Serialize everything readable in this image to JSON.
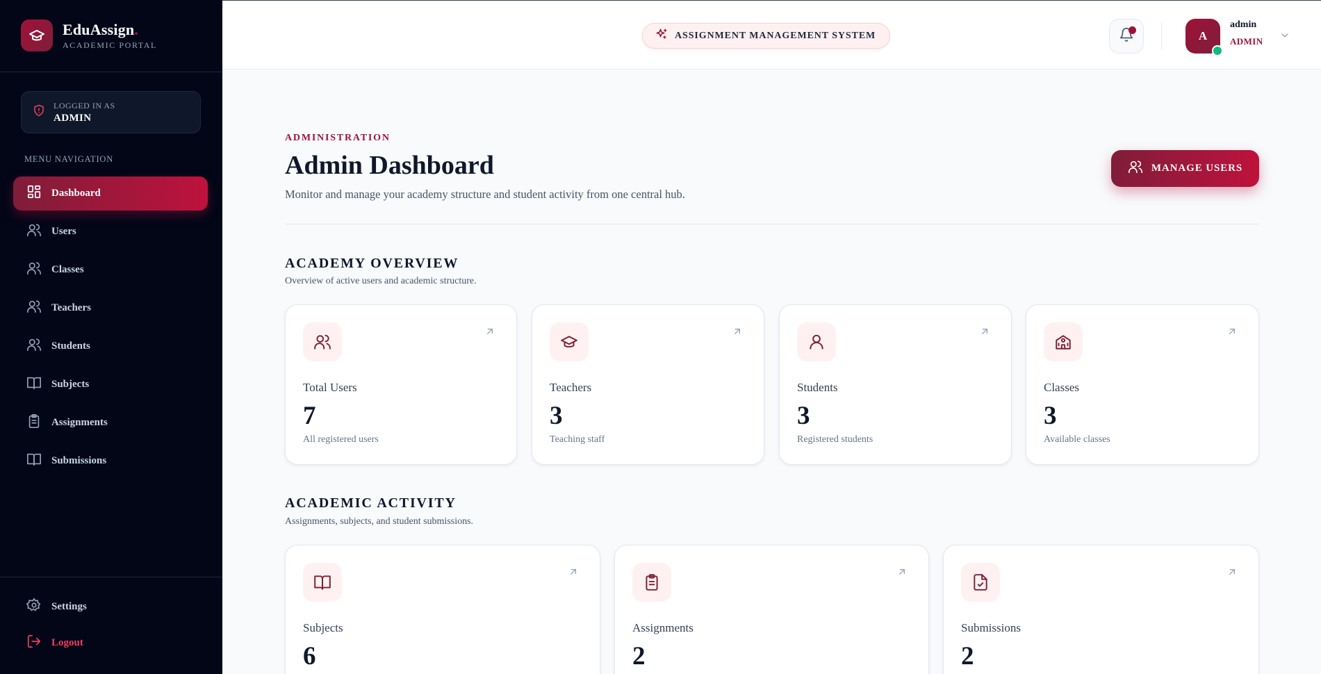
{
  "brand": {
    "name": "EduAssign",
    "dot": ".",
    "subtitle": "ACADEMIC PORTAL"
  },
  "login": {
    "label": "LOGGED IN AS",
    "role": "ADMIN"
  },
  "menu": {
    "heading": "MENU NAVIGATION",
    "items": [
      {
        "label": "Dashboard",
        "icon": "dashboard-icon",
        "active": true
      },
      {
        "label": "Users",
        "icon": "users-icon"
      },
      {
        "label": "Classes",
        "icon": "users-icon"
      },
      {
        "label": "Teachers",
        "icon": "users-icon"
      },
      {
        "label": "Students",
        "icon": "users-icon"
      },
      {
        "label": "Subjects",
        "icon": "book-icon"
      },
      {
        "label": "Assignments",
        "icon": "clipboard-icon"
      },
      {
        "label": "Submissions",
        "icon": "book-icon"
      }
    ],
    "bottom": [
      {
        "label": "Settings",
        "icon": "gear-icon"
      },
      {
        "label": "Logout",
        "icon": "logout-icon"
      }
    ]
  },
  "header": {
    "system_label": "ASSIGNMENT MANAGEMENT SYSTEM",
    "user": {
      "initial": "A",
      "name": "admin",
      "role": "ADMIN"
    }
  },
  "page": {
    "eyebrow": "ADMINISTRATION",
    "title": "Admin Dashboard",
    "description": "Monitor and manage your academy structure and student activity from one central hub.",
    "manage_users_label": "MANAGE USERS"
  },
  "overview": {
    "title": "ACADEMY OVERVIEW",
    "description": "Overview of active users and academic structure.",
    "cards": [
      {
        "label": "Total Users",
        "value": "7",
        "sub": "All registered users",
        "icon": "users-icon"
      },
      {
        "label": "Teachers",
        "value": "3",
        "sub": "Teaching staff",
        "icon": "graduation-cap-icon"
      },
      {
        "label": "Students",
        "value": "3",
        "sub": "Registered students",
        "icon": "user-icon"
      },
      {
        "label": "Classes",
        "value": "3",
        "sub": "Available classes",
        "icon": "school-icon"
      }
    ]
  },
  "activity": {
    "title": "ACADEMIC ACTIVITY",
    "description": "Assignments, subjects, and student submissions.",
    "cards": [
      {
        "label": "Subjects",
        "value": "6",
        "icon": "book-icon"
      },
      {
        "label": "Assignments",
        "value": "2",
        "icon": "clipboard-icon"
      },
      {
        "label": "Submissions",
        "value": "2",
        "icon": "file-check-icon"
      }
    ]
  },
  "colors": {
    "accent": "#9f1239",
    "sidebar_bg": "#020617",
    "online": "#10b981"
  }
}
